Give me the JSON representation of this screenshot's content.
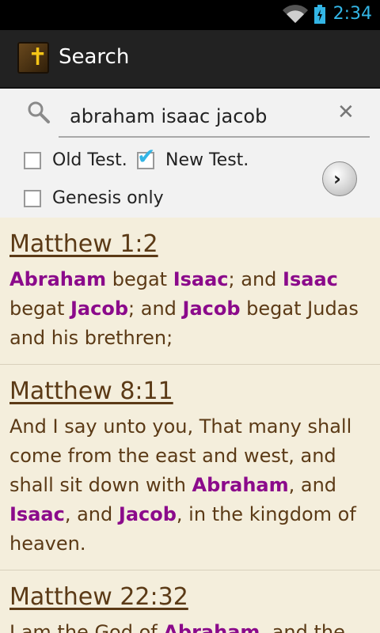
{
  "status_bar": {
    "time": "2:34"
  },
  "action_bar": {
    "title": "Search"
  },
  "search": {
    "query": "abraham isaac jacob"
  },
  "filters": {
    "old_test": {
      "label": "Old Test.",
      "checked": false
    },
    "new_test": {
      "label": "New Test.",
      "checked": true
    },
    "genesis_only": {
      "label": "Genesis only",
      "checked": false
    }
  },
  "results": [
    {
      "reference": "Matthew 1:2",
      "segments": [
        {
          "t": "Abraham",
          "h": true
        },
        {
          "t": " begat ",
          "h": false
        },
        {
          "t": "Isaac",
          "h": true
        },
        {
          "t": "; and ",
          "h": false
        },
        {
          "t": "Isaac",
          "h": true
        },
        {
          "t": " begat ",
          "h": false
        },
        {
          "t": "Jacob",
          "h": true
        },
        {
          "t": "; and ",
          "h": false
        },
        {
          "t": "Jacob",
          "h": true
        },
        {
          "t": " begat Judas and his brethren;",
          "h": false
        }
      ]
    },
    {
      "reference": "Matthew 8:11",
      "segments": [
        {
          "t": "And I say unto you, That many shall come from the east and west, and shall sit down with ",
          "h": false
        },
        {
          "t": "Abraham",
          "h": true
        },
        {
          "t": ", and ",
          "h": false
        },
        {
          "t": "Isaac",
          "h": true
        },
        {
          "t": ", and ",
          "h": false
        },
        {
          "t": "Jacob",
          "h": true
        },
        {
          "t": ", in the kingdom of heaven.",
          "h": false
        }
      ]
    },
    {
      "reference": "Matthew 22:32",
      "segments": [
        {
          "t": "I am the God of ",
          "h": false
        },
        {
          "t": "Abraham",
          "h": true
        },
        {
          "t": ", and the",
          "h": false
        }
      ]
    }
  ]
}
